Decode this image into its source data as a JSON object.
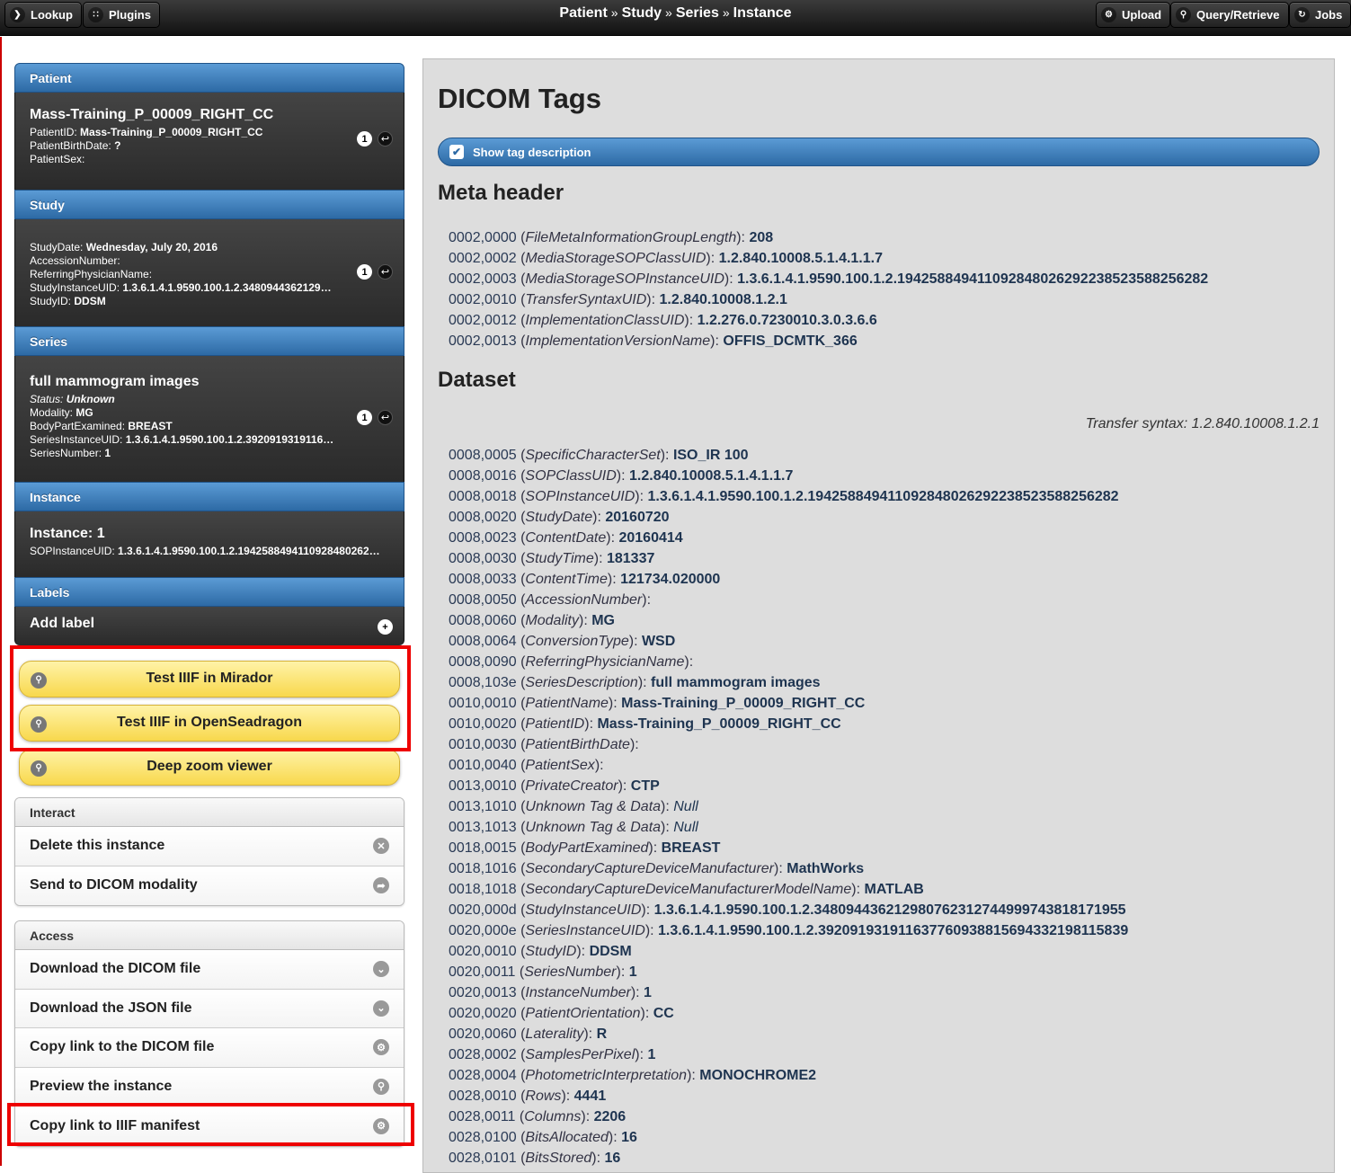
{
  "topbar": {
    "lookup": "Lookup",
    "plugins": "Plugins",
    "breadcrumb": [
      "Patient",
      "Study",
      "Series",
      "Instance"
    ],
    "sep": "»",
    "upload": "Upload",
    "query": "Query/Retrieve",
    "jobs": "Jobs"
  },
  "sidebar": {
    "patient": {
      "header": "Patient",
      "name": "Mass-Training_P_00009_RIGHT_CC",
      "count": "1",
      "lines": [
        {
          "k": "PatientID: ",
          "v": "Mass-Training_P_00009_RIGHT_CC"
        },
        {
          "k": "PatientBirthDate: ",
          "v": "?"
        },
        {
          "k": "PatientSex:",
          "v": ""
        }
      ]
    },
    "study": {
      "header": "Study",
      "count": "1",
      "lines": [
        {
          "k": "StudyDate: ",
          "v": "Wednesday, July 20, 2016"
        },
        {
          "k": "AccessionNumber:",
          "v": ""
        },
        {
          "k": "ReferringPhysicianName:",
          "v": ""
        },
        {
          "k": "StudyInstanceUID: ",
          "v": "1.3.6.1.4.1.9590.100.1.2.3480944362129…"
        },
        {
          "k": "StudyID: ",
          "v": "DDSM"
        }
      ]
    },
    "series": {
      "header": "Series",
      "name": "full mammogram images",
      "count": "1",
      "status_k": "Status: ",
      "status_v": "Unknown",
      "lines": [
        {
          "k": "Modality: ",
          "v": "MG"
        },
        {
          "k": "BodyPartExamined: ",
          "v": "BREAST"
        },
        {
          "k": "SeriesInstanceUID: ",
          "v": "1.3.6.1.4.1.9590.100.1.2.3920919319116…"
        },
        {
          "k": "SeriesNumber: ",
          "v": "1"
        }
      ]
    },
    "instance": {
      "header": "Instance",
      "name": "Instance: 1",
      "lines": [
        {
          "k": "SOPInstanceUID: ",
          "v": "1.3.6.1.4.1.9590.100.1.2.1942588494110928480262…"
        }
      ]
    },
    "labels": {
      "header": "Labels",
      "add": "Add label"
    },
    "yellow_buttons": [
      "Test IIIF in Mirador",
      "Test IIIF in OpenSeadragon",
      "Deep zoom viewer"
    ],
    "interact": {
      "header": "Interact",
      "items": [
        "Delete this instance",
        "Send to DICOM modality"
      ]
    },
    "access": {
      "header": "Access",
      "items": [
        "Download the DICOM file",
        "Download the JSON file",
        "Copy link to the DICOM file",
        "Preview the instance",
        "Copy link to IIIF manifest"
      ]
    }
  },
  "main": {
    "title": "DICOM Tags",
    "show_desc": "Show tag description",
    "meta_title": "Meta header",
    "dataset_title": "Dataset",
    "transfer_syntax": "Transfer syntax: 1.2.840.10008.1.2.1",
    "meta_tags": [
      {
        "id": "0002,0000",
        "name": "FileMetaInformationGroupLength",
        "value": "208"
      },
      {
        "id": "0002,0002",
        "name": "MediaStorageSOPClassUID",
        "value": "1.2.840.10008.5.1.4.1.1.7"
      },
      {
        "id": "0002,0003",
        "name": "MediaStorageSOPInstanceUID",
        "value": "1.3.6.1.4.1.9590.100.1.2.194258849411092848026292238523588256282"
      },
      {
        "id": "0002,0010",
        "name": "TransferSyntaxUID",
        "value": "1.2.840.10008.1.2.1"
      },
      {
        "id": "0002,0012",
        "name": "ImplementationClassUID",
        "value": "1.2.276.0.7230010.3.0.3.6.6"
      },
      {
        "id": "0002,0013",
        "name": "ImplementationVersionName",
        "value": "OFFIS_DCMTK_366"
      }
    ],
    "dataset_tags": [
      {
        "id": "0008,0005",
        "name": "SpecificCharacterSet",
        "value": "ISO_IR 100"
      },
      {
        "id": "0008,0016",
        "name": "SOPClassUID",
        "value": "1.2.840.10008.5.1.4.1.1.7"
      },
      {
        "id": "0008,0018",
        "name": "SOPInstanceUID",
        "value": "1.3.6.1.4.1.9590.100.1.2.194258849411092848026292238523588256282"
      },
      {
        "id": "0008,0020",
        "name": "StudyDate",
        "value": "20160720"
      },
      {
        "id": "0008,0023",
        "name": "ContentDate",
        "value": "20160414"
      },
      {
        "id": "0008,0030",
        "name": "StudyTime",
        "value": "181337"
      },
      {
        "id": "0008,0033",
        "name": "ContentTime",
        "value": "121734.020000"
      },
      {
        "id": "0008,0050",
        "name": "AccessionNumber",
        "value": ""
      },
      {
        "id": "0008,0060",
        "name": "Modality",
        "value": "MG"
      },
      {
        "id": "0008,0064",
        "name": "ConversionType",
        "value": "WSD"
      },
      {
        "id": "0008,0090",
        "name": "ReferringPhysicianName",
        "value": ""
      },
      {
        "id": "0008,103e",
        "name": "SeriesDescription",
        "value": "full mammogram images"
      },
      {
        "id": "0010,0010",
        "name": "PatientName",
        "value": "Mass-Training_P_00009_RIGHT_CC"
      },
      {
        "id": "0010,0020",
        "name": "PatientID",
        "value": "Mass-Training_P_00009_RIGHT_CC"
      },
      {
        "id": "0010,0030",
        "name": "PatientBirthDate",
        "value": ""
      },
      {
        "id": "0010,0040",
        "name": "PatientSex",
        "value": ""
      },
      {
        "id": "0013,0010",
        "name": "PrivateCreator",
        "value": "CTP"
      },
      {
        "id": "0013,1010",
        "name": "Unknown Tag & Data",
        "value": "Null",
        "null": true
      },
      {
        "id": "0013,1013",
        "name": "Unknown Tag & Data",
        "value": "Null",
        "null": true
      },
      {
        "id": "0018,0015",
        "name": "BodyPartExamined",
        "value": "BREAST"
      },
      {
        "id": "0018,1016",
        "name": "SecondaryCaptureDeviceManufacturer",
        "value": "MathWorks"
      },
      {
        "id": "0018,1018",
        "name": "SecondaryCaptureDeviceManufacturerModelName",
        "value": "MATLAB"
      },
      {
        "id": "0020,000d",
        "name": "StudyInstanceUID",
        "value": "1.3.6.1.4.1.9590.100.1.2.348094436212980762312744999743818171955"
      },
      {
        "id": "0020,000e",
        "name": "SeriesInstanceUID",
        "value": "1.3.6.1.4.1.9590.100.1.2.392091931911637760938815694332198115839"
      },
      {
        "id": "0020,0010",
        "name": "StudyID",
        "value": "DDSM"
      },
      {
        "id": "0020,0011",
        "name": "SeriesNumber",
        "value": "1"
      },
      {
        "id": "0020,0013",
        "name": "InstanceNumber",
        "value": "1"
      },
      {
        "id": "0020,0020",
        "name": "PatientOrientation",
        "value": "CC"
      },
      {
        "id": "0020,0060",
        "name": "Laterality",
        "value": "R"
      },
      {
        "id": "0028,0002",
        "name": "SamplesPerPixel",
        "value": "1"
      },
      {
        "id": "0028,0004",
        "name": "PhotometricInterpretation",
        "value": "MONOCHROME2"
      },
      {
        "id": "0028,0010",
        "name": "Rows",
        "value": "4441"
      },
      {
        "id": "0028,0011",
        "name": "Columns",
        "value": "2206"
      },
      {
        "id": "0028,0100",
        "name": "BitsAllocated",
        "value": "16"
      },
      {
        "id": "0028,0101",
        "name": "BitsStored",
        "value": "16"
      }
    ]
  }
}
